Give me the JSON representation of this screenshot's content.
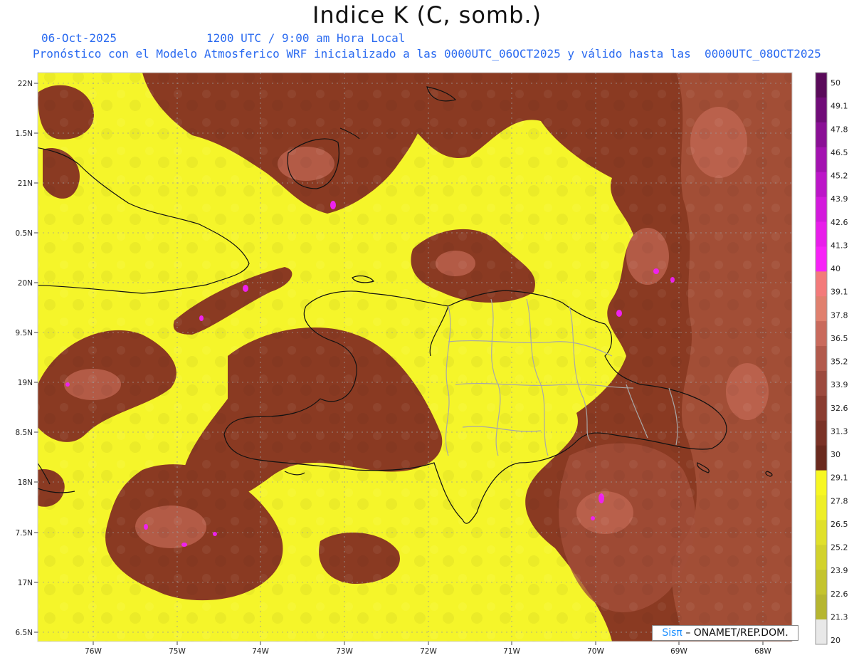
{
  "header": {
    "title": "Indice K (C, somb.)",
    "date": "06-Oct-2025",
    "time": "1200 UTC / 9:00 am Hora Local",
    "forecast": "Pronóstico con el Modelo Atmosferico WRF inicializado a las 0000UTC_06OCT2025 y válido hasta las  0000UTC_08OCT2025"
  },
  "axes": {
    "lat_labels": [
      "22N",
      "1.5N",
      "21N",
      "0.5N",
      "20N",
      "9.5N",
      "19N",
      "8.5N",
      "18N",
      "7.5N",
      "17N",
      "6.5N"
    ],
    "lon_labels": [
      "76W",
      "75W",
      "74W",
      "73W",
      "72W",
      "71W",
      "70W",
      "69W",
      "68W"
    ]
  },
  "colorbar": {
    "levels": [
      "50",
      "49.1",
      "47.8",
      "46.5",
      "45.2",
      "43.9",
      "42.6",
      "41.3",
      "40",
      "39.1",
      "37.8",
      "36.5",
      "35.2",
      "33.9",
      "32.6",
      "31.3",
      "30",
      "29.1",
      "27.8",
      "26.5",
      "25.2",
      "23.9",
      "22.6",
      "21.3",
      "20"
    ],
    "colors": [
      "#5a0a5a",
      "#700c78",
      "#8a0f95",
      "#a312b0",
      "#bc16c8",
      "#d31adc",
      "#e81eea",
      "#f722f7",
      "#f37a7a",
      "#e0806e",
      "#c96a5c",
      "#b25a4c",
      "#9c4a3e",
      "#8a3c30",
      "#7a3226",
      "#6a2a1e",
      "#f7f722",
      "#eeee26",
      "#e0e02a",
      "#d2d22c",
      "#c4c42e",
      "#b6b630",
      "#e8e8e8"
    ]
  },
  "colors": {
    "low": "#f5f52a",
    "mid": "#8a3a22",
    "high": "#c46a55",
    "extreme": "#ee22ee"
  },
  "credit": {
    "brand": "Sisπ",
    "org": "– ONAMET/REP.DOM."
  }
}
